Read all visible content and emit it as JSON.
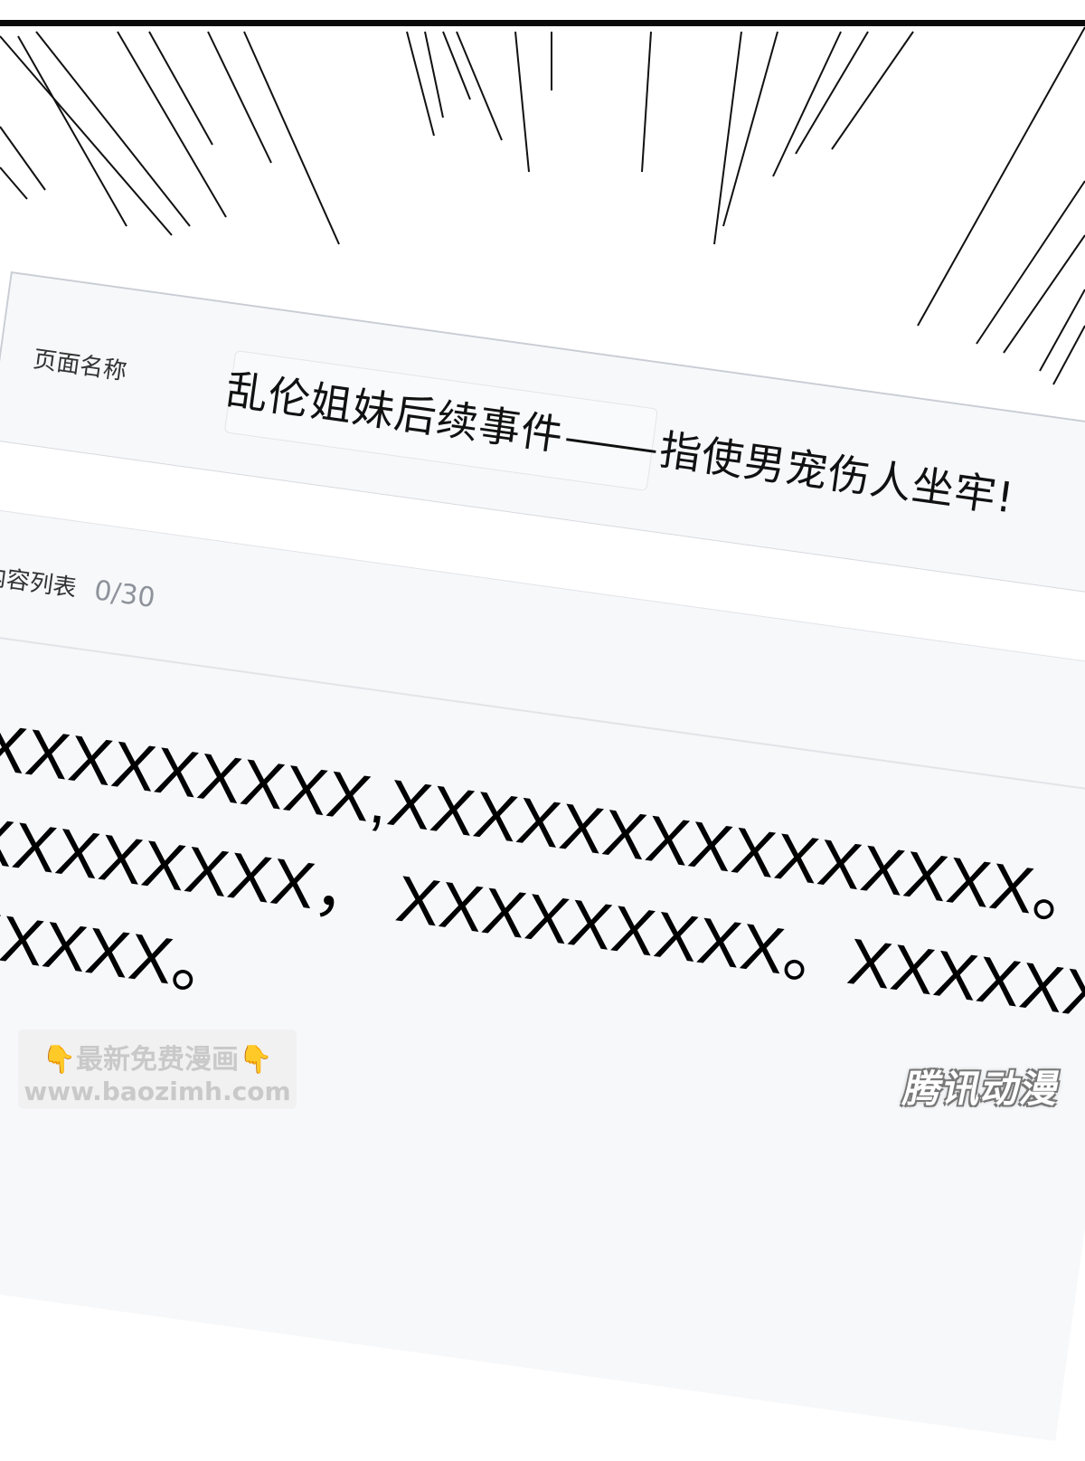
{
  "card": {
    "name_label": "页面名称",
    "title": "乱伦姐妹后续事件",
    "title_tail": "指使男宠伤人坐牢!",
    "list_label": "内容列表",
    "list_count": "0/30",
    "content_text": "XXXXXXXXX,XXXXXXXXXXXXXXX。XXXX\nXXXXXXXX， XXXXXXXXX。XXXXXXXX\nXXXXX。"
  },
  "watermark": {
    "hand": "👇",
    "line1": "最新免费漫画",
    "line2": "www.baozimh.com"
  },
  "brand": {
    "text": "腾讯动漫"
  },
  "colors": {
    "panel": "#f7f8fa",
    "border": "#c9cdd4",
    "speed_lines": "#111111"
  }
}
